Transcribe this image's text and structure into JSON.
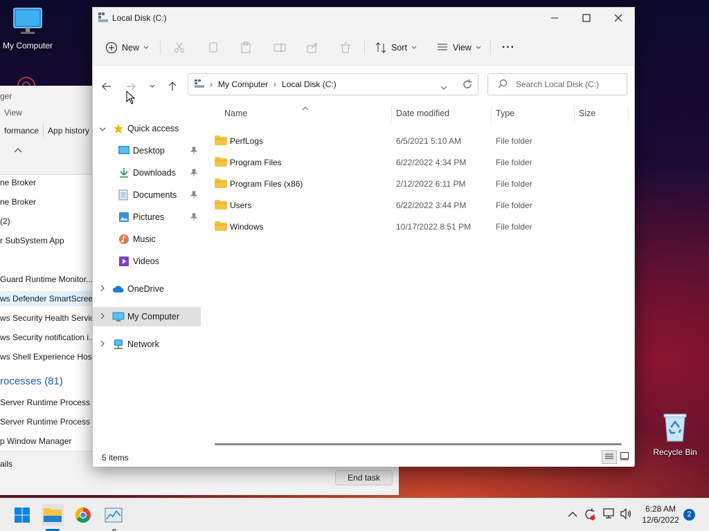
{
  "desktop": {
    "my_computer_label": "My Computer",
    "recycle_bin_label": "Recycle Bin"
  },
  "task_manager": {
    "title_fragment": "ger",
    "menu_view": "View",
    "tab_performance": "formance",
    "tab_app_history": "App history",
    "rows": [
      "ne Broker",
      "ne Broker",
      " (2)",
      "r SubSystem App",
      "",
      " Guard Runtime Monitor...",
      "ws Defender SmartScreen",
      "ws Security Health Service",
      "ws Security notification i...",
      "ws Shell Experience Host",
      "rocesses (81)",
      "Server Runtime Process",
      "Server Runtime Process",
      "p Window Manager"
    ],
    "details_fragment": "ails",
    "end_task": "End task"
  },
  "explorer": {
    "title": "Local Disk (C:)",
    "toolbar": {
      "new_label": "New",
      "sort_label": "Sort",
      "view_label": "View",
      "more_label": "···"
    },
    "breadcrumb": [
      "My Computer",
      "Local Disk (C:)"
    ],
    "search_placeholder": "Search Local Disk (C:)",
    "nav": {
      "quick_access": "Quick access",
      "desktop": "Desktop",
      "downloads": "Downloads",
      "documents": "Documents",
      "pictures": "Pictures",
      "music": "Music",
      "videos": "Videos",
      "onedrive": "OneDrive",
      "my_computer": "My Computer",
      "network": "Network"
    },
    "columns": {
      "name": "Name",
      "date": "Date modified",
      "type": "Type",
      "size": "Size"
    },
    "files": [
      {
        "name": "PerfLogs",
        "date": "6/5/2021 5:10 AM",
        "type": "File folder"
      },
      {
        "name": "Program Files",
        "date": "6/22/2022 4:34 PM",
        "type": "File folder"
      },
      {
        "name": "Program Files (x86)",
        "date": "2/12/2022 6:11 PM",
        "type": "File folder"
      },
      {
        "name": "Users",
        "date": "6/22/2022 3:44 PM",
        "type": "File folder"
      },
      {
        "name": "Windows",
        "date": "10/17/2022 8:51 PM",
        "type": "File folder"
      }
    ],
    "status": "5 items"
  },
  "taskbar": {
    "time": "6:28 AM",
    "date": "12/6/2022",
    "notification_count": "2"
  },
  "colors": {
    "folder": "#f4c542",
    "accent": "#0067c0",
    "selection": "#e0e0e0"
  }
}
